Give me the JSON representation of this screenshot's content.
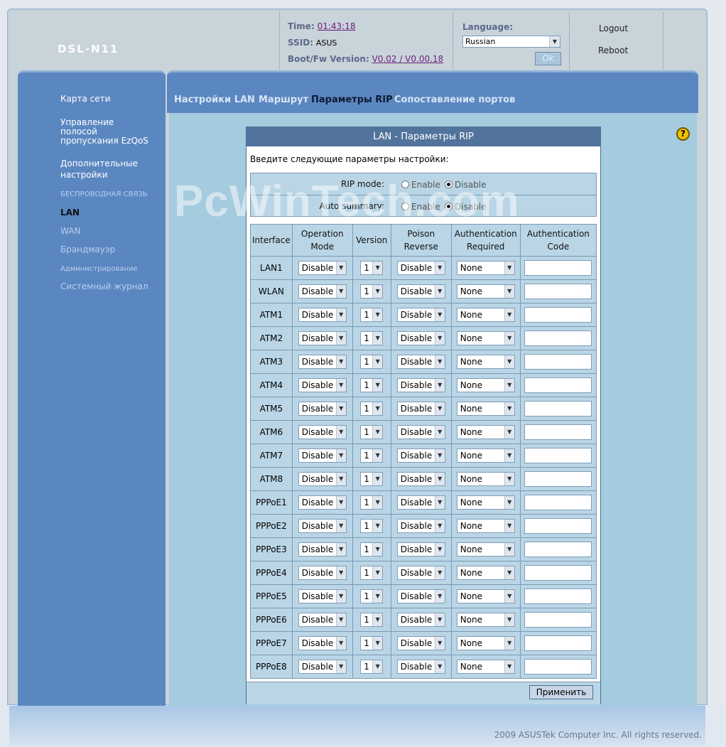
{
  "header": {
    "model": "DSL-N11",
    "time_label": "Time:",
    "time_value": "01:43:18",
    "ssid_label": "SSID:",
    "ssid_value": "ASUS",
    "fw_label": "Boot/Fw Version:",
    "fw_value": "V0.02 / V0.00.18",
    "language_label": "Language:",
    "language_value": "Russian",
    "ok_label": "Ok",
    "logout_label": "Logout",
    "reboot_label": "Reboot"
  },
  "sidebar": {
    "items": [
      {
        "label": "Карта сети"
      },
      {
        "label": "Управление полосой пропускания EzQoS"
      },
      {
        "label": "Дополнительные настройки"
      },
      {
        "label": "БЕСПРОВОДНАЯ СВЯЗЬ"
      },
      {
        "label": "LAN"
      },
      {
        "label": "WAN"
      },
      {
        "label": "Брандмауэр"
      },
      {
        "label": "Администрирование"
      },
      {
        "label": "Системный журнал"
      }
    ]
  },
  "tabs": [
    {
      "label": "Настройки LAN"
    },
    {
      "label": "Маршрут"
    },
    {
      "label": "Параметры RIP"
    },
    {
      "label": "Сопоставление портов"
    }
  ],
  "panel": {
    "title": "LAN - Параметры RIP",
    "intro": "Введите следующие параметры настройки:",
    "rip_mode_label": "RIP mode:",
    "auto_summary_label": "Auto summary:",
    "enable_label": "Enable",
    "disable_label": "Disable",
    "rip_mode_value": "Disable",
    "auto_summary_value": "Disable",
    "apply_label": "Применить"
  },
  "table": {
    "headers": [
      "Interface",
      "Operation Mode",
      "Version",
      "Poison Reverse",
      "Authentication Required",
      "Authentication Code"
    ],
    "rows": [
      {
        "iface": "LAN1",
        "mode": "Disable",
        "version": "1",
        "poison": "Disable",
        "auth": "None",
        "code": ""
      },
      {
        "iface": "WLAN",
        "mode": "Disable",
        "version": "1",
        "poison": "Disable",
        "auth": "None",
        "code": ""
      },
      {
        "iface": "ATM1",
        "mode": "Disable",
        "version": "1",
        "poison": "Disable",
        "auth": "None",
        "code": ""
      },
      {
        "iface": "ATM2",
        "mode": "Disable",
        "version": "1",
        "poison": "Disable",
        "auth": "None",
        "code": ""
      },
      {
        "iface": "ATM3",
        "mode": "Disable",
        "version": "1",
        "poison": "Disable",
        "auth": "None",
        "code": ""
      },
      {
        "iface": "ATM4",
        "mode": "Disable",
        "version": "1",
        "poison": "Disable",
        "auth": "None",
        "code": ""
      },
      {
        "iface": "ATM5",
        "mode": "Disable",
        "version": "1",
        "poison": "Disable",
        "auth": "None",
        "code": ""
      },
      {
        "iface": "ATM6",
        "mode": "Disable",
        "version": "1",
        "poison": "Disable",
        "auth": "None",
        "code": ""
      },
      {
        "iface": "ATM7",
        "mode": "Disable",
        "version": "1",
        "poison": "Disable",
        "auth": "None",
        "code": ""
      },
      {
        "iface": "ATM8",
        "mode": "Disable",
        "version": "1",
        "poison": "Disable",
        "auth": "None",
        "code": ""
      },
      {
        "iface": "PPPoE1",
        "mode": "Disable",
        "version": "1",
        "poison": "Disable",
        "auth": "None",
        "code": ""
      },
      {
        "iface": "PPPoE2",
        "mode": "Disable",
        "version": "1",
        "poison": "Disable",
        "auth": "None",
        "code": ""
      },
      {
        "iface": "PPPoE3",
        "mode": "Disable",
        "version": "1",
        "poison": "Disable",
        "auth": "None",
        "code": ""
      },
      {
        "iface": "PPPoE4",
        "mode": "Disable",
        "version": "1",
        "poison": "Disable",
        "auth": "None",
        "code": ""
      },
      {
        "iface": "PPPoE5",
        "mode": "Disable",
        "version": "1",
        "poison": "Disable",
        "auth": "None",
        "code": ""
      },
      {
        "iface": "PPPoE6",
        "mode": "Disable",
        "version": "1",
        "poison": "Disable",
        "auth": "None",
        "code": ""
      },
      {
        "iface": "PPPoE7",
        "mode": "Disable",
        "version": "1",
        "poison": "Disable",
        "auth": "None",
        "code": ""
      },
      {
        "iface": "PPPoE8",
        "mode": "Disable",
        "version": "1",
        "poison": "Disable",
        "auth": "None",
        "code": ""
      }
    ]
  },
  "watermark": "PcWinTech.com",
  "footer": {
    "copyright": "2009 ASUSTek Computer Inc. All rights reserved."
  },
  "icons": {
    "help": "help-icon",
    "dropdown": "chevron-down-icon"
  },
  "colors": {
    "sidebar": "#5b87c1",
    "panel_header": "#51739c",
    "content_bg": "#a5cbdf",
    "link": "#6b1f7a"
  }
}
